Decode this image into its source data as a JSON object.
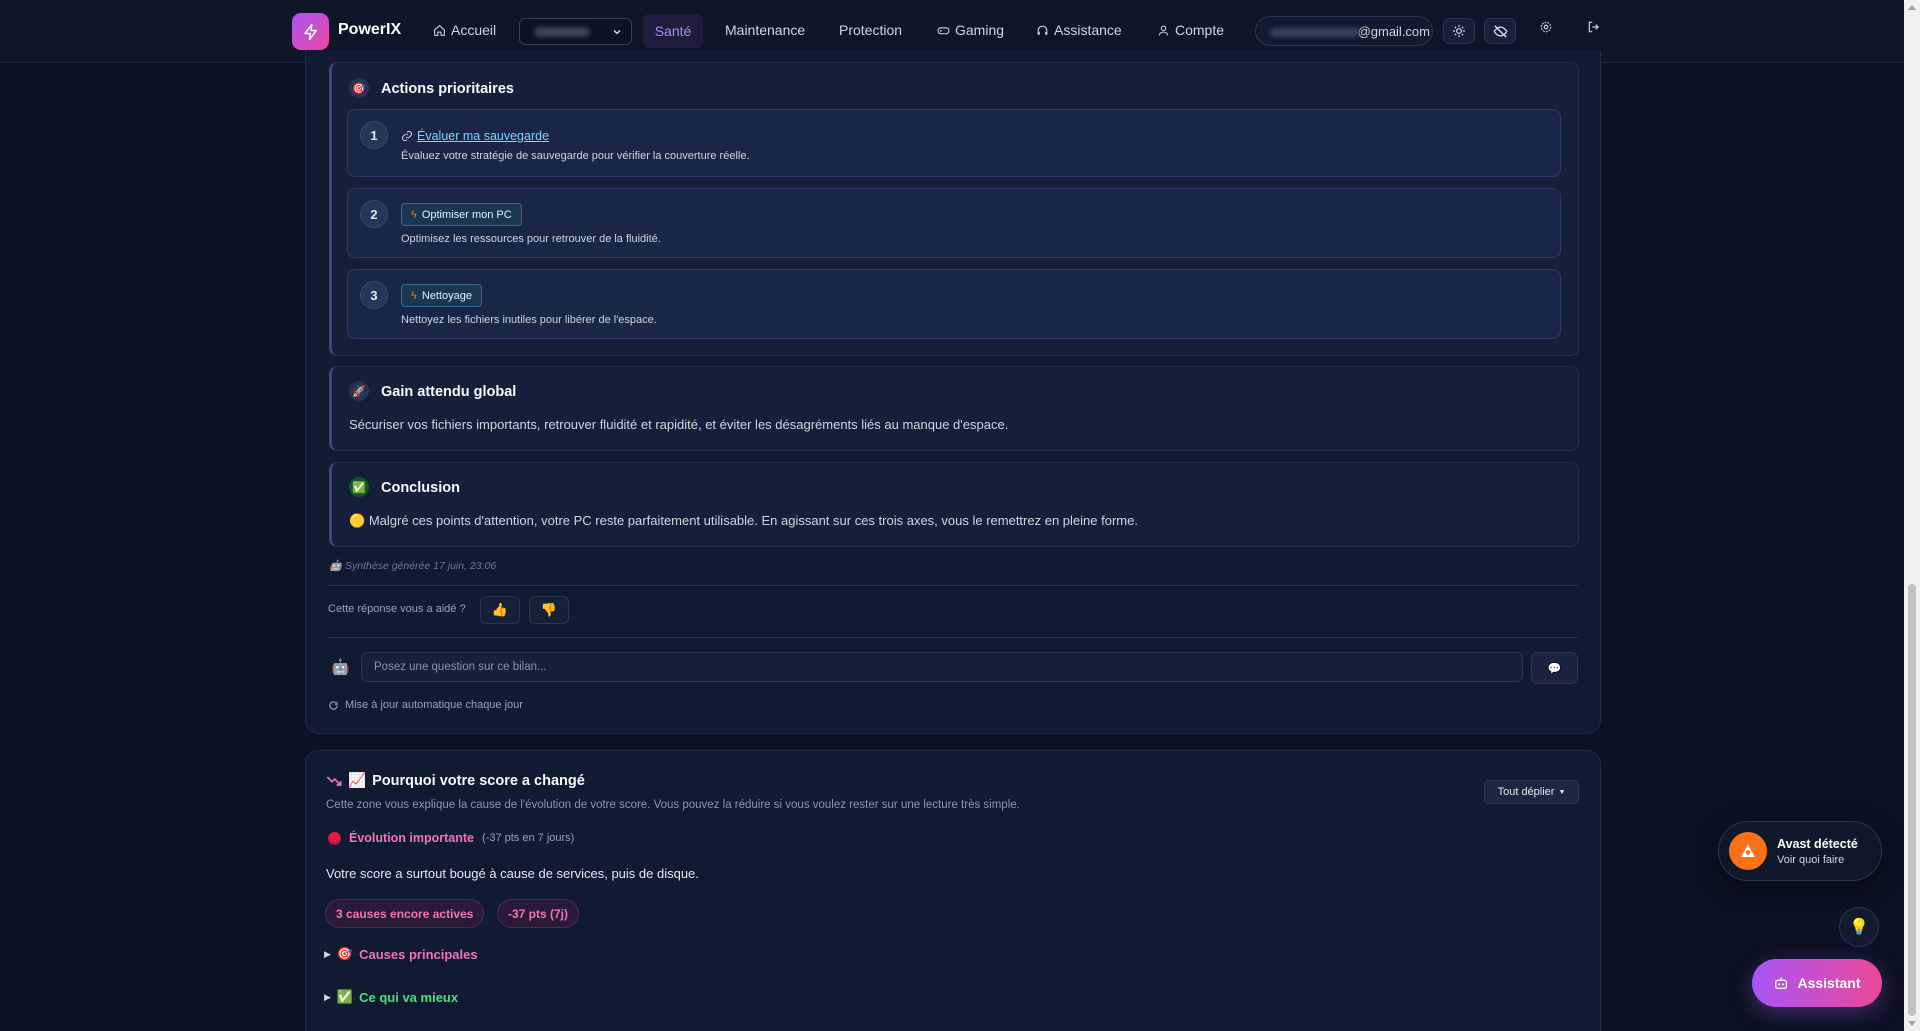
{
  "nav": {
    "brand": "PowerIX",
    "items": [
      {
        "label": "Accueil",
        "icon": "home-icon"
      },
      {
        "label": "Santé",
        "icon": "",
        "active": true
      },
      {
        "label": "Maintenance",
        "icon": ""
      },
      {
        "label": "Protection",
        "icon": ""
      },
      {
        "label": "Gaming",
        "icon": "gamepad-icon"
      },
      {
        "label": "Assistance",
        "icon": "headset-icon"
      },
      {
        "label": "Compte",
        "icon": "user-icon"
      }
    ],
    "email_suffix": "@gmail.com",
    "accent": "#a78bfa"
  },
  "actions": {
    "title": "Actions prioritaires",
    "steps": [
      {
        "num": "1",
        "link": "Évaluer ma sauvegarde",
        "desc": "Évaluez votre stratégie de sauvegarde pour vérifier la couverture réelle."
      },
      {
        "num": "2",
        "pill": "Optimiser mon PC",
        "desc": "Optimisez les ressources pour retrouver de la fluidité."
      },
      {
        "num": "3",
        "pill": "Nettoyage",
        "desc": "Nettoyez les fichiers inutiles pour libérer de l'espace."
      }
    ]
  },
  "gain": {
    "title": "Gain attendu global",
    "text": "Sécuriser vos fichiers importants, retrouver fluidité et rapidité, et éviter les désagréments liés au manque d'espace."
  },
  "conclusion": {
    "title": "Conclusion",
    "text": "Malgré ces points d'attention, votre PC reste parfaitement utilisable. En agissant sur ces trois axes, vous le remettrez en pleine forme."
  },
  "synthesis": "Synthèse générée 17 juin, 23:06",
  "feedback": {
    "label": "Cette réponse vous a aidé ?",
    "up": "👍",
    "down": "👎"
  },
  "ask": {
    "placeholder": "Posez une question sur ce bilan...",
    "send": "💬"
  },
  "auto_update": "Mise à jour automatique chaque jour",
  "score": {
    "title": "Pourquoi votre score a changé",
    "subtitle": "Cette zone vous explique la cause de l'évolution de votre score. Vous pouvez la réduire si vous voulez rester sur une lecture très simple.",
    "expand": "Tout déplier",
    "evolution_label": "Évolution importante",
    "evolution_pts": "(-37 pts en 7 jours)",
    "text": "Votre score a surtout bougé à cause de services, puis de disque.",
    "tags": [
      "3 causes encore actives",
      "-37 pts (7j)"
    ],
    "sections": [
      {
        "label": "Causes principales",
        "color": "#f472b6"
      },
      {
        "label": "Ce qui va mieux",
        "color": "#4ade80"
      }
    ]
  },
  "avast": {
    "title": "Avast détecté",
    "sub": "Voir quoi faire"
  },
  "assistant": "Assistant"
}
